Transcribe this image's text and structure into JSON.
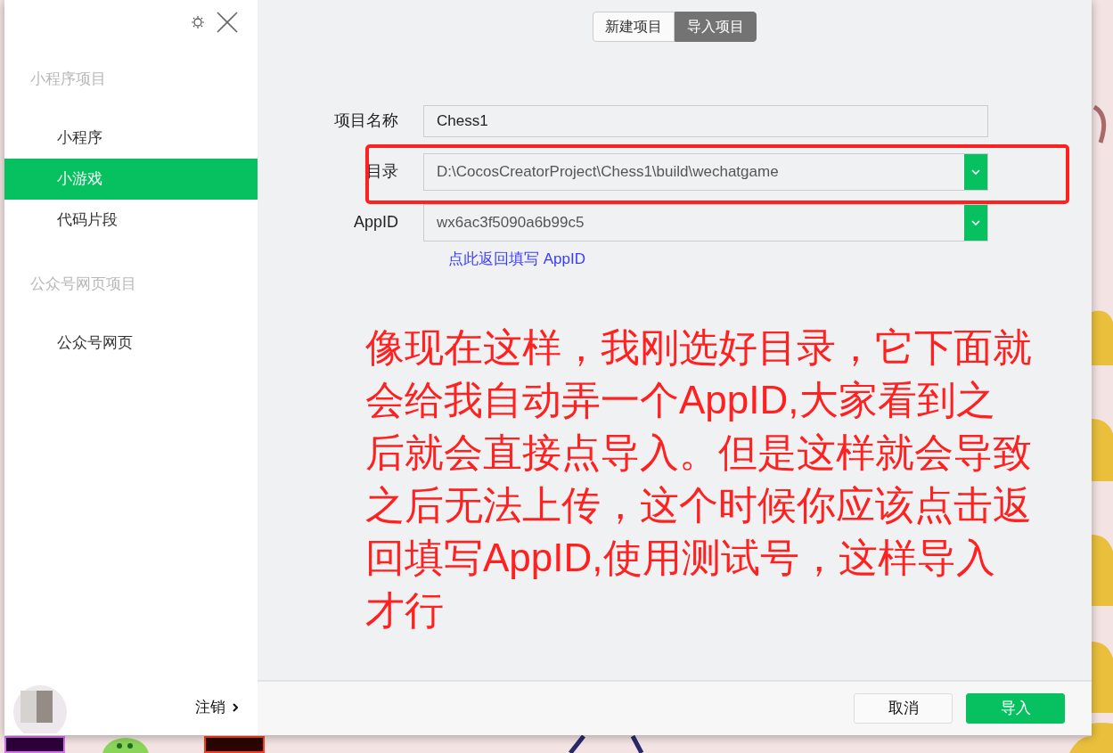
{
  "sidebar": {
    "sections": [
      {
        "title": "小程序项目",
        "items": [
          {
            "label": "小程序",
            "selected": false
          },
          {
            "label": "小游戏",
            "selected": true
          },
          {
            "label": "代码片段",
            "selected": false
          }
        ]
      },
      {
        "title": "公众号网页项目",
        "items": [
          {
            "label": "公众号网页",
            "selected": false
          }
        ]
      }
    ],
    "logout": "注销"
  },
  "tabs": [
    {
      "label": "新建项目",
      "selected": false
    },
    {
      "label": "导入项目",
      "selected": true
    }
  ],
  "form": {
    "fields": [
      {
        "label": "项目名称",
        "value": "Chess1",
        "dropdown": false,
        "highlighted": false
      },
      {
        "label": "目录",
        "value": "D:\\CocosCreatorProject\\Chess1\\build\\wechatgame",
        "dropdown": true,
        "highlighted": true
      },
      {
        "label": "AppID",
        "value": "wx6ac3f5090a6b99c5",
        "dropdown": true,
        "highlighted": false
      }
    ],
    "link": "点此返回填写 AppID"
  },
  "annotation_lines": [
    "像现在这样，我刚选好目录，它下面就",
    "会给我自动弄一个AppID,大家看到之",
    "后就会直接点导入。但是这样就会导致",
    "之后无法上传，这个时候你应该点击返",
    "回填写AppID,使用测试号，这样导入",
    "才行"
  ],
  "buttons": [
    {
      "label": "取消",
      "kind": "secondary"
    },
    {
      "label": "导入",
      "kind": "primary"
    }
  ]
}
